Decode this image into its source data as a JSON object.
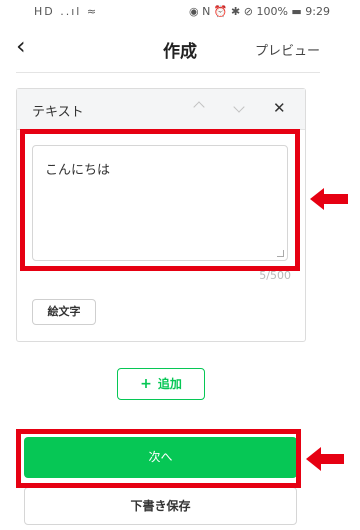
{
  "status_bar": {
    "left_icons": "HD ..ıl ≈",
    "right_text": "◉ N ⏰ ✱ ⊘ 100% ▬ 9:29"
  },
  "header": {
    "back_icon": "chevron-left-icon",
    "title": "作成",
    "preview_label": "プレビュー"
  },
  "card": {
    "title": "テキスト",
    "text_value": "こんにちは",
    "counter": "5/500",
    "emoji_label": "絵文字"
  },
  "add_button": {
    "label": "追加"
  },
  "next_button": {
    "label": "次へ"
  },
  "draft_button": {
    "label": "下書き保存"
  },
  "colors": {
    "brand_green": "#06c755",
    "annotation_red": "#e60012"
  }
}
